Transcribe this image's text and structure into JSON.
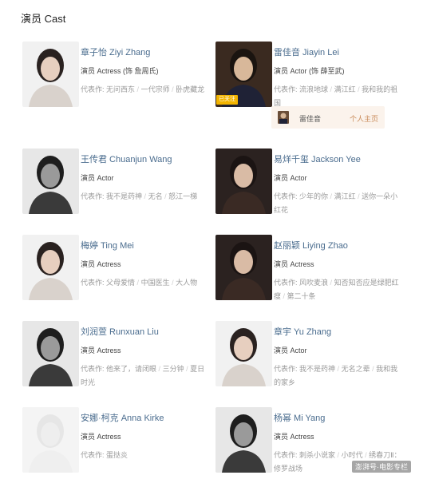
{
  "title": "演员 Cast",
  "works_label": "代表作:",
  "separator": " / ",
  "cast": [
    {
      "name": "章子怡 Ziyi Zhang",
      "role": "演员 Actress (饰 詹周氏)",
      "works": [
        "无问西东",
        "一代宗师",
        "卧虎藏龙"
      ],
      "photo": "light"
    },
    {
      "name": "雷佳音 Jiayin Lei",
      "role": "演员 Actor (饰 薛至武)",
      "works": [
        "流浪地球",
        "满江红",
        "我和我的祖国"
      ],
      "photo": "dark",
      "badge": "已关注"
    },
    {
      "name": "王传君 Chuanjun Wang",
      "role": "演员 Actor",
      "works": [
        "我不是药神",
        "无名",
        "怒江一梯"
      ],
      "photo": "bw"
    },
    {
      "name": "易烊千玺 Jackson Yee",
      "role": "演员 Actor",
      "works": [
        "少年的你",
        "满江红",
        "送你一朵小红花"
      ],
      "photo": "darkwarm"
    },
    {
      "name": "梅婷 Ting Mei",
      "role": "演员 Actress",
      "works": [
        "父母爱情",
        "中国医生",
        "大人物"
      ],
      "photo": "light"
    },
    {
      "name": "赵丽颖 Liying Zhao",
      "role": "演员 Actress",
      "works": [
        "风吹麦浪",
        "知否知否应是绿肥红瘦",
        "第二十条"
      ],
      "photo": "darkwarm"
    },
    {
      "name": "刘润萱 Runxuan Liu",
      "role": "演员 Actress",
      "works": [
        "他来了，请闭眼",
        "三分钟",
        "夏日时光"
      ],
      "photo": "bw"
    },
    {
      "name": "章宇 Yu Zhang",
      "role": "演员 Actor",
      "works": [
        "我不是药神",
        "无名之辈",
        "我和我的家乡"
      ],
      "photo": "light"
    },
    {
      "name": "安娜·柯克 Anna Kirke",
      "role": "演员 Actress",
      "works": [
        "蛋挞炎"
      ],
      "photo": "blank"
    },
    {
      "name": "杨幂 Mi Yang",
      "role": "演员 Actress",
      "works": [
        "刺杀小说家",
        "小时代",
        "绣春刀Ⅱ：修罗战场"
      ],
      "photo": "bw"
    }
  ],
  "related": {
    "name": "雷佳音",
    "tag": "个人主页"
  },
  "watermark": "澎湃号·电影专栏",
  "colors": {
    "name_link": "#4a6c8e",
    "badge": "#f2b400",
    "related_bg": "#fbf3ec"
  }
}
